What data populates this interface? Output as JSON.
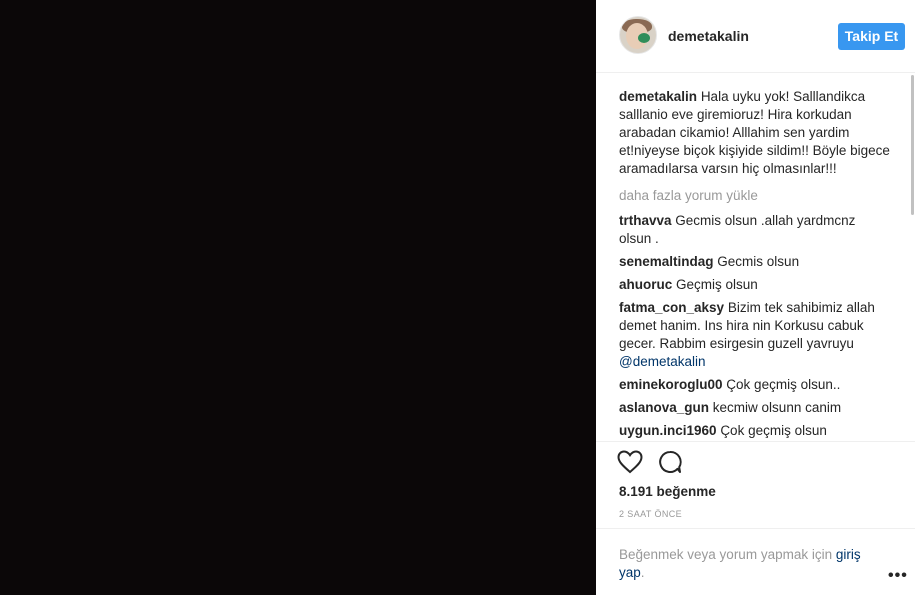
{
  "post": {
    "username": "demetakalin",
    "follow_label": "Takip Et",
    "caption": "Hala uyku yok! Salllandikca salllanio eve giremioruz! Hira korkudan arabadan cikamio! Alllahim sen yardim et!niyeyse biçok kişiyide sildim!! Böyle bigece aramadılarsa varsın hiç olmasınlar!!!",
    "load_more": "daha fazla yorum yükle",
    "comments": [
      {
        "user": "trthavva",
        "text": "Gecmis olsun .allah yardmcnz olsun ."
      },
      {
        "user": "senemaltindag",
        "text": "Gecmis olsun"
      },
      {
        "user": "ahuoruc",
        "text": "Geçmiş olsun"
      },
      {
        "user": "fatma_con_aksy",
        "text": "Bizim tek sahibimiz allah demet hanim. Ins hira nin Korkusu cabuk gecer. Rabbim esirgesin guzell yavruyu",
        "mention": "@demetakalin"
      },
      {
        "user": "eminekoroglu00",
        "text": "Çok geçmiş olsun.."
      },
      {
        "user": "aslanova_gun",
        "text": "kecmiw olsunn canim"
      },
      {
        "user": "uygun.inci1960",
        "text": "Çok geçmiş olsun"
      }
    ],
    "likes": "8.191 beğenme",
    "timestamp": "2 SAAT ÖNCE",
    "login_prefix": "Beğenmek veya yorum yapmak için",
    "login_link": "giriş yap",
    "login_suffix": ".",
    "icons": {
      "like": "heart-icon",
      "comment": "comment-icon",
      "more": "more-options-icon"
    },
    "colors": {
      "accent": "#3897f0",
      "media_bg": "#0b0708",
      "link": "#003569"
    }
  }
}
